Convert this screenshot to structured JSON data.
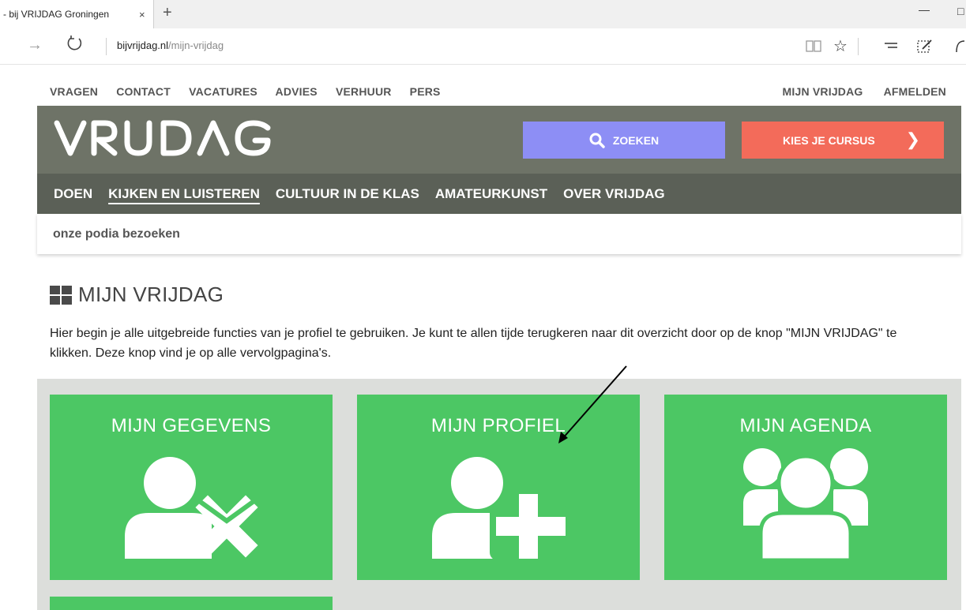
{
  "browser": {
    "tab_title": "- bij VRIJDAG Groningen",
    "tab_close": "×",
    "new_tab": "+",
    "address_host": "bijvrijdag.nl",
    "address_path": "/mijn-vrijdag",
    "icons": [
      "forward-icon",
      "refresh-icon",
      "reading-view-icon",
      "favorite-star-icon",
      "hub-icon",
      "web-note-icon",
      "share-icon"
    ]
  },
  "toplinks": {
    "left": [
      "VRAGEN",
      "CONTACT",
      "VACATURES",
      "ADVIES",
      "VERHUUR",
      "PERS"
    ],
    "right": [
      "MIJN VRIJDAG",
      "AFMELDEN"
    ]
  },
  "header": {
    "logo_text": "VRIJDAG",
    "search_label": "ZOEKEN",
    "course_label": "KIES JE CURSUS",
    "colors": {
      "header_bg": "#6e7367",
      "search_bg": "#8d8ef5",
      "course_bg": "#f36b5a"
    }
  },
  "mainnav": {
    "items": [
      "DOEN",
      "KIJKEN EN LUISTEREN",
      "CULTUUR IN DE KLAS",
      "AMATEURKUNST",
      "OVER VRIJDAG"
    ],
    "active": "KIJKEN EN LUISTEREN"
  },
  "subnav": {
    "item": "onze podia bezoeken"
  },
  "page": {
    "title": "MIJN VRIJDAG",
    "intro": "Hier begin je alle uitgebreide functies van je profiel te gebruiken. Je kunt te allen tijde terugkeren naar dit overzicht door op de knop \"MIJN VRIJDAG\" te klikken. Deze knop vind je op alle vervolgpagina's."
  },
  "tiles": [
    {
      "title": "MIJN GEGEVENS",
      "icon": "user-remove-icon"
    },
    {
      "title": "MIJN PROFIEL",
      "icon": "user-add-icon"
    },
    {
      "title": "MIJN AGENDA",
      "icon": "group-icon"
    }
  ],
  "accent_green": "#4cc764"
}
